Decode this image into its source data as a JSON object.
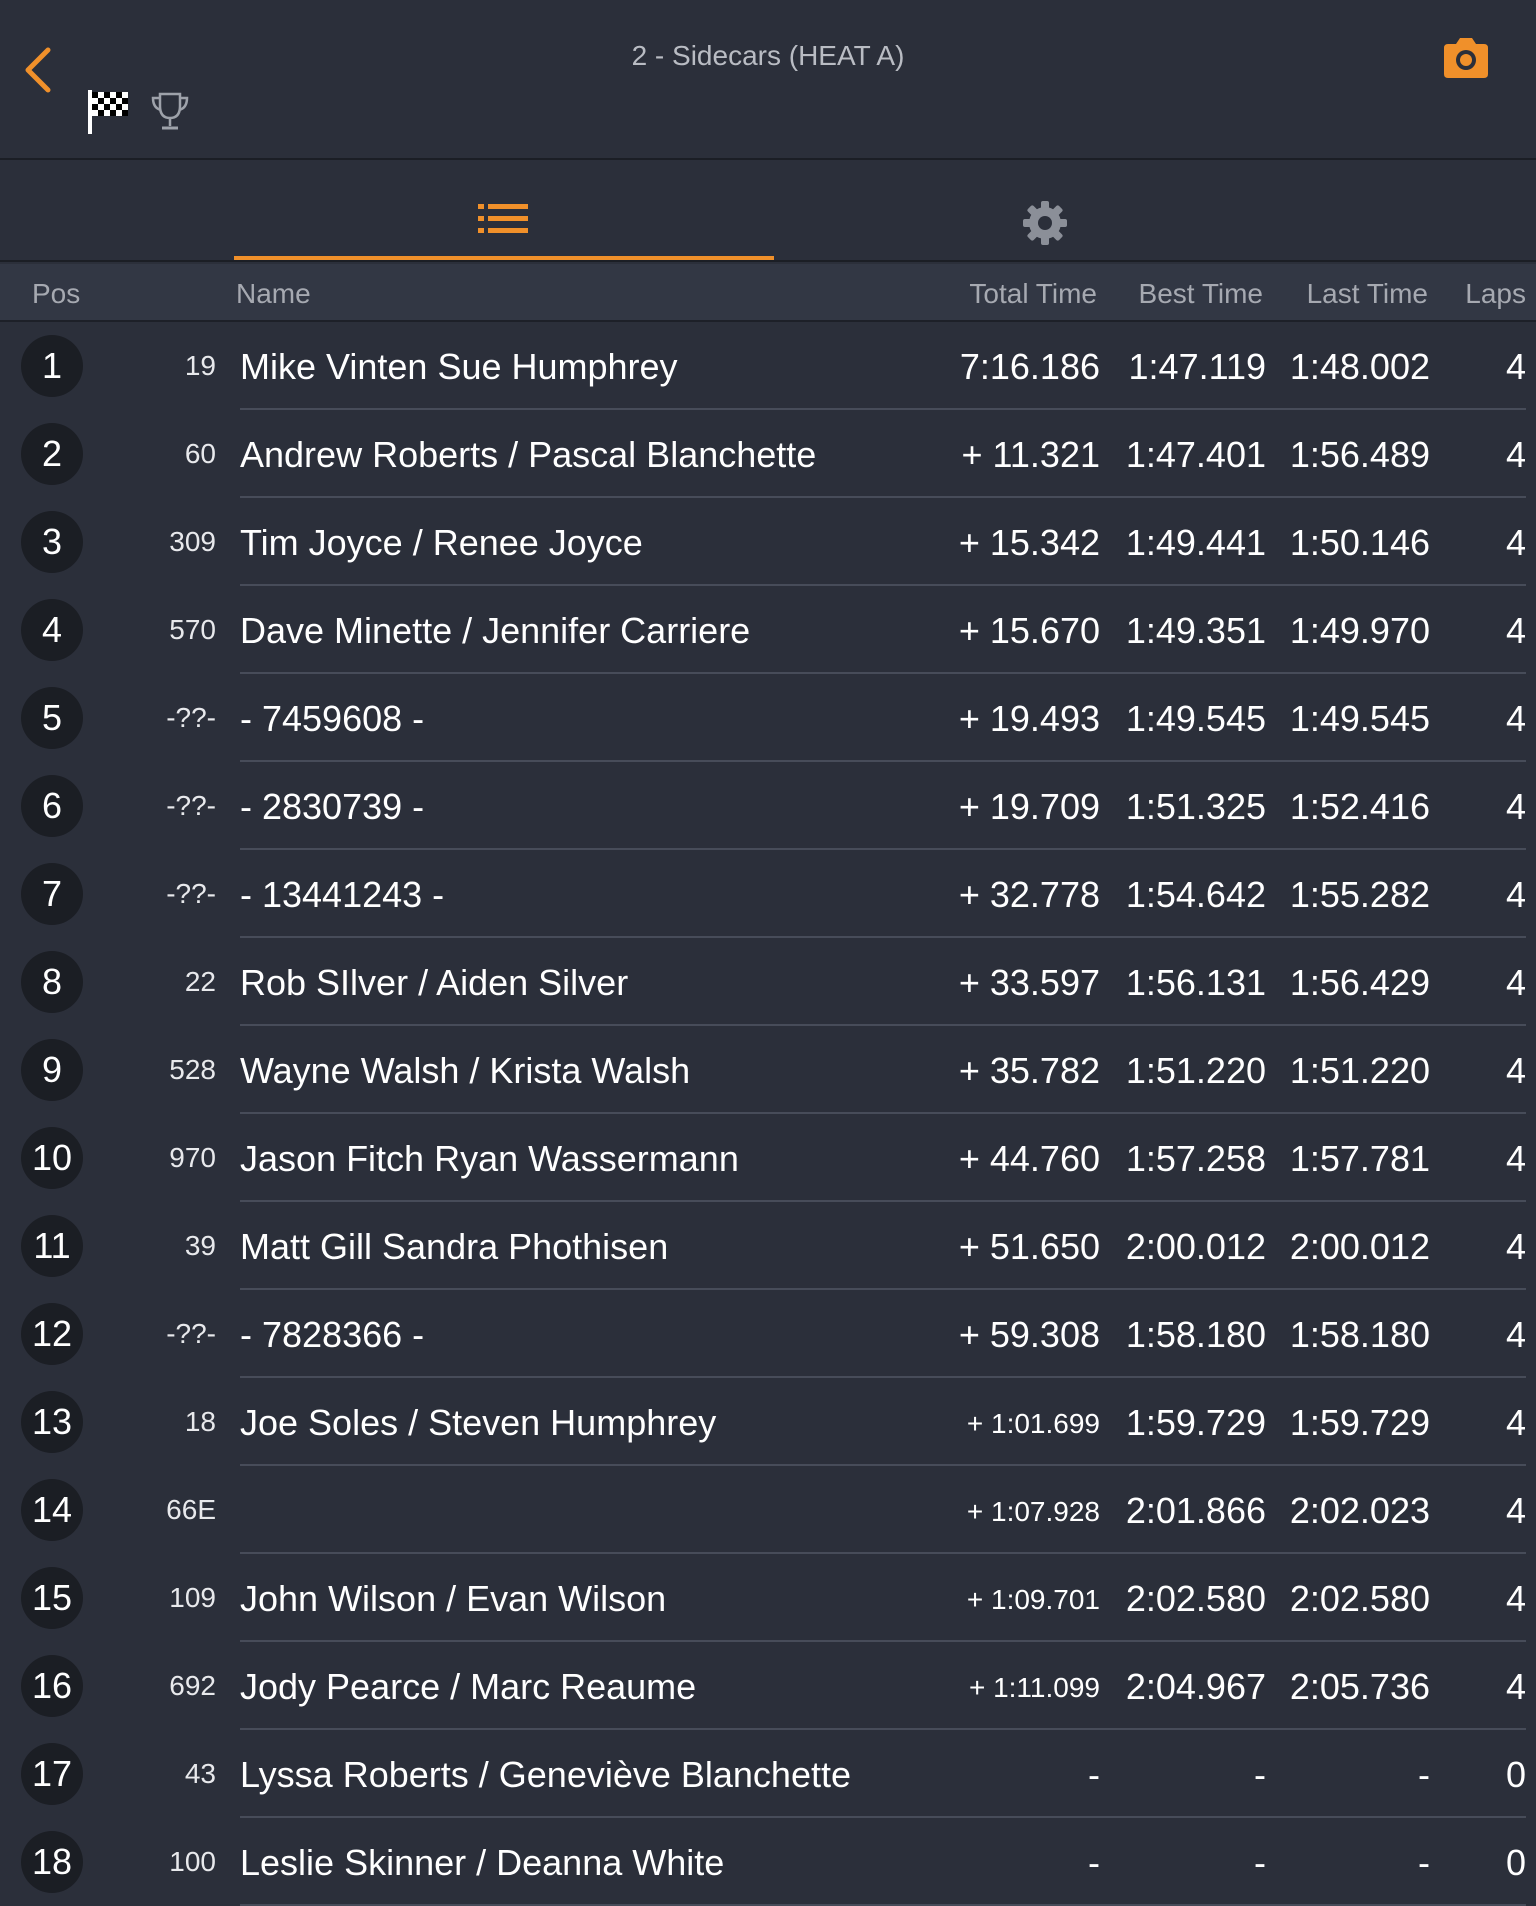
{
  "header": {
    "title": "2 - Sidecars (HEAT A)",
    "back_icon": "chevron-left-icon",
    "flag_icon": "checkered-flag-icon",
    "trophy_icon": "trophy-icon",
    "camera_icon": "camera-icon",
    "accent_color": "#f0902a"
  },
  "tabs": [
    {
      "icon": "list-icon",
      "selected": true
    },
    {
      "icon": "gear-icon",
      "selected": false
    }
  ],
  "columns": {
    "pos": "Pos",
    "name": "Name",
    "total": "Total Time",
    "best": "Best Time",
    "last": "Last Time",
    "laps": "Laps"
  },
  "rows": [
    {
      "pos": "1",
      "num": "19",
      "name": "Mike Vinten Sue Humphrey",
      "total": "7:16.186",
      "best": "1:47.119",
      "last": "1:48.002",
      "laps": "4"
    },
    {
      "pos": "2",
      "num": "60",
      "name": "Andrew Roberts /  Pascal Blanchette",
      "total": "+ 11.321",
      "best": "1:47.401",
      "last": "1:56.489",
      "laps": "4"
    },
    {
      "pos": "3",
      "num": "309",
      "name": "Tim Joyce /  Renee Joyce",
      "total": "+ 15.342",
      "best": "1:49.441",
      "last": "1:50.146",
      "laps": "4"
    },
    {
      "pos": "4",
      "num": "570",
      "name": "Dave Minette /  Jennifer Carriere",
      "total": "+ 15.670",
      "best": "1:49.351",
      "last": "1:49.970",
      "laps": "4"
    },
    {
      "pos": "5",
      "num": "-??-",
      "name": "- 7459608 -",
      "total": "+ 19.493",
      "best": "1:49.545",
      "last": "1:49.545",
      "laps": "4"
    },
    {
      "pos": "6",
      "num": "-??-",
      "name": "- 2830739 -",
      "total": "+ 19.709",
      "best": "1:51.325",
      "last": "1:52.416",
      "laps": "4"
    },
    {
      "pos": "7",
      "num": "-??-",
      "name": "- 13441243 -",
      "total": "+ 32.778",
      "best": "1:54.642",
      "last": "1:55.282",
      "laps": "4"
    },
    {
      "pos": "8",
      "num": "22",
      "name": "Rob SIlver /  Aiden Silver",
      "total": "+ 33.597",
      "best": "1:56.131",
      "last": "1:56.429",
      "laps": "4"
    },
    {
      "pos": "9",
      "num": "528",
      "name": "Wayne Walsh /  Krista Walsh",
      "total": "+ 35.782",
      "best": "1:51.220",
      "last": "1:51.220",
      "laps": "4"
    },
    {
      "pos": "10",
      "num": "970",
      "name": "Jason Fitch Ryan Wassermann",
      "total": "+ 44.760",
      "best": "1:57.258",
      "last": "1:57.781",
      "laps": "4"
    },
    {
      "pos": "11",
      "num": "39",
      "name": "Matt Gill Sandra Phothisen",
      "total": "+ 51.650",
      "best": "2:00.012",
      "last": "2:00.012",
      "laps": "4"
    },
    {
      "pos": "12",
      "num": "-??-",
      "name": "- 7828366 -",
      "total": "+ 59.308",
      "best": "1:58.180",
      "last": "1:58.180",
      "laps": "4"
    },
    {
      "pos": "13",
      "num": "18",
      "name": "Joe Soles /  Steven Humphrey",
      "total": "+ 1:01.699",
      "best": "1:59.729",
      "last": "1:59.729",
      "laps": "4"
    },
    {
      "pos": "14",
      "num": "66E",
      "name": "",
      "total": "+ 1:07.928",
      "best": "2:01.866",
      "last": "2:02.023",
      "laps": "4"
    },
    {
      "pos": "15",
      "num": "109",
      "name": "John Wilson /  Evan Wilson",
      "total": "+ 1:09.701",
      "best": "2:02.580",
      "last": "2:02.580",
      "laps": "4"
    },
    {
      "pos": "16",
      "num": "692",
      "name": "Jody Pearce /  Marc Reaume",
      "total": "+ 1:11.099",
      "best": "2:04.967",
      "last": "2:05.736",
      "laps": "4"
    },
    {
      "pos": "17",
      "num": "43",
      "name": "Lyssa Roberts /  Geneviève Blanchette",
      "total": "-",
      "best": "-",
      "last": "-",
      "laps": "0"
    },
    {
      "pos": "18",
      "num": "100",
      "name": "Leslie Skinner /  Deanna White",
      "total": "-",
      "best": "-",
      "last": "-",
      "laps": "0"
    }
  ]
}
